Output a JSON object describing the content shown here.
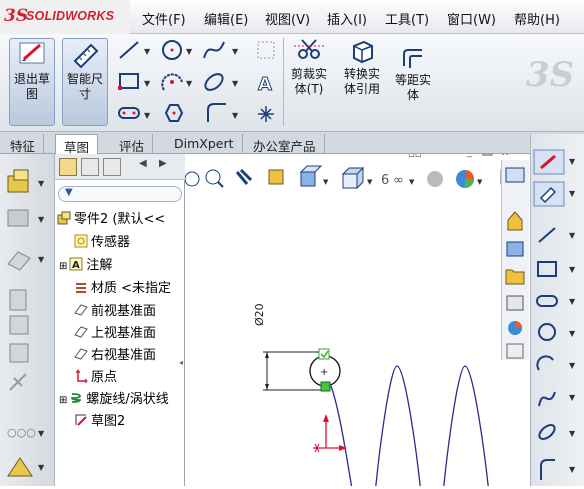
{
  "app": {
    "logo_mark": "3S",
    "logo_text": "SOLIDWORKS"
  },
  "menu": [
    "文件(F)",
    "编辑(E)",
    "视图(V)",
    "插入(I)",
    "工具(T)",
    "窗口(W)",
    "帮助(H)"
  ],
  "commands": {
    "exit_sketch": "退出草\n图",
    "smart_dim": "智能尺\n寸",
    "trim": "剪裁实\n体(T)",
    "convert": "转换实\n体引用",
    "offset": "等距实\n体"
  },
  "tabs": [
    "特征",
    "草图",
    "评估",
    "DimXpert",
    "办公室产品"
  ],
  "active_tab": "草图",
  "tree": {
    "root": "零件2 (默认<<",
    "items": [
      "传感器",
      "注解",
      "材质 <未指定",
      "前视基准面",
      "上视基准面",
      "右视基准面",
      "原点",
      "螺旋线/涡状线",
      "草图2"
    ]
  },
  "drawing": {
    "dimension": "Ø20"
  },
  "colors": {
    "accent": "#d6202b",
    "curve": "#2b2b8a",
    "select": "#3cc83c"
  }
}
